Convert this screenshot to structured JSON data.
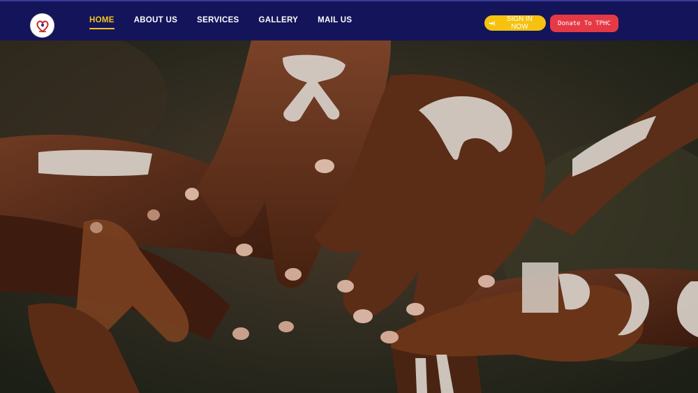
{
  "nav": {
    "logo_icon": "tphc-logo-heart-icon",
    "links": [
      "HOME",
      "ABOUT US",
      "SERVICES",
      "GALLERY",
      "MAIL US"
    ],
    "active_index": 0
  },
  "actions": {
    "signin_label": "SIGN IN NOW",
    "signin_icon": "sign-in-icon",
    "donate_label": "Donate To TPHC"
  },
  "hero": {
    "image_alt_icon": "stacked-hands-adinkra-photo"
  },
  "colors": {
    "nav_bg": "#14145a",
    "accent_yellow": "#f5c518",
    "donate_red": "#e63946"
  }
}
